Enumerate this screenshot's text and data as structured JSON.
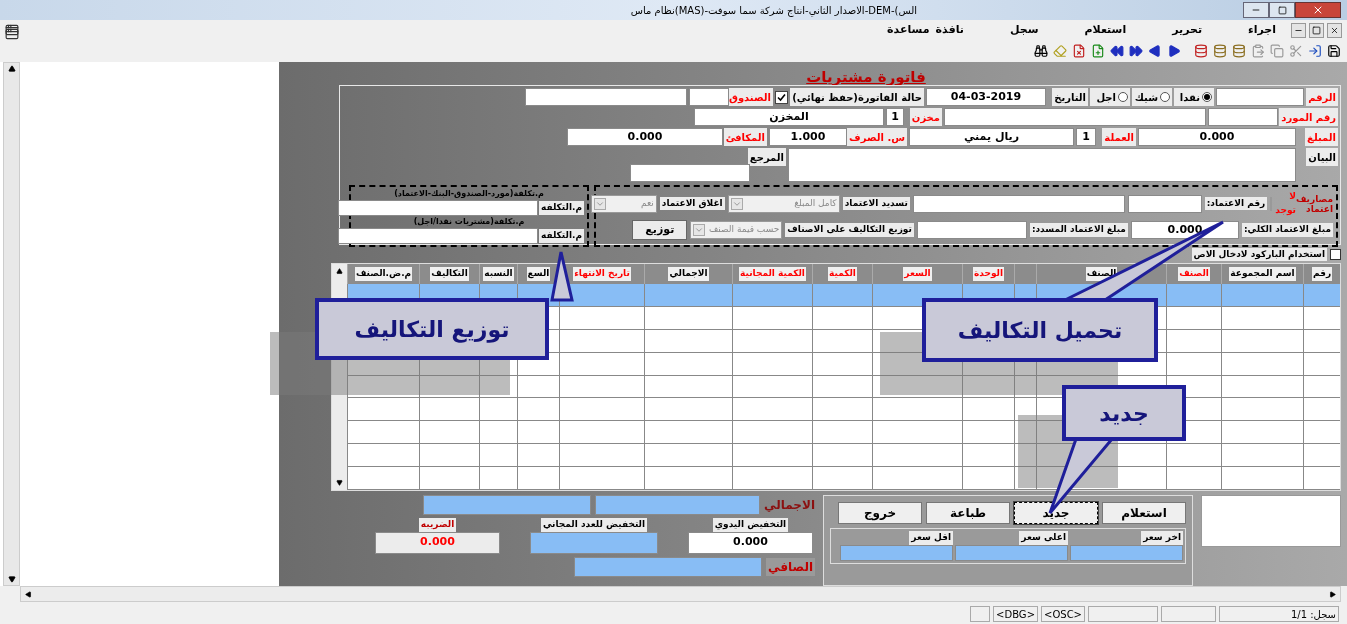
{
  "window": {
    "title": "نظام ماس(MAS)-الاصدار الثاني-انتاج شركة سما سوفت-DEM-(الس"
  },
  "menu": [
    "اجراء",
    "تحرير",
    "استعلام",
    "سجل",
    "نافذة",
    "مساعدة"
  ],
  "form": {
    "title": "فاتورة مشتريات",
    "rows": [
      {
        "items": [
          {
            "kind": "label",
            "text": "الرقم",
            "color": "#ff0000"
          },
          {
            "kind": "field"
          },
          {
            "kind": "radio",
            "text": "نقدا",
            "selected": true
          },
          {
            "kind": "radio",
            "text": "شيك",
            "selected": false
          },
          {
            "kind": "radio",
            "text": "اجل",
            "selected": false
          },
          {
            "kind": "label",
            "text": "التاريخ",
            "color": "#000000"
          },
          {
            "kind": "field",
            "value": "04-03-2019"
          },
          {
            "kind": "label",
            "text": "حالة الفاتورة(حفظ نهائي)",
            "color": "#000000"
          },
          {
            "kind": "check",
            "checked": true
          },
          {
            "kind": "label",
            "text": "الصندوق",
            "color": "#ff0000"
          },
          {
            "kind": "field"
          },
          {
            "kind": "field"
          }
        ]
      },
      {
        "items": [
          {
            "kind": "label",
            "text": "رقم المورد",
            "color": "#ff0000"
          },
          {
            "kind": "field"
          },
          {
            "kind": "field"
          },
          {
            "kind": "label",
            "text": "مخزن",
            "color": "#ff0000"
          },
          {
            "kind": "field",
            "value": "1"
          },
          {
            "kind": "field",
            "value": "المخزن"
          }
        ]
      },
      {
        "items": [
          {
            "kind": "label",
            "text": "المبلغ",
            "color": "#ff0000"
          },
          {
            "kind": "field",
            "value": "0.000"
          },
          {
            "kind": "label",
            "text": "العملة",
            "color": "#ff0000"
          },
          {
            "kind": "field",
            "value": "1"
          },
          {
            "kind": "field",
            "value": "ريال يمني"
          },
          {
            "kind": "label",
            "text": "س. الصرف",
            "color": "#ff0000"
          },
          {
            "kind": "field",
            "value": "1.000"
          },
          {
            "kind": "label",
            "text": "المكافئ",
            "color": "#ff0000"
          },
          {
            "kind": "field",
            "value": "0.000"
          }
        ]
      },
      {
        "items": [
          {
            "kind": "label",
            "text": "البيان",
            "color": "#000000"
          },
          {
            "kind": "memo"
          },
          {
            "kind": "label",
            "text": "المرجع",
            "color": "#000000"
          },
          {
            "kind": "field"
          }
        ]
      }
    ],
    "credit": {
      "title": "مصاريف اعتماد",
      "status": "لا توجد",
      "number_label": "رقم الاعتماد:",
      "settle_label": "تسديد الاعتماد",
      "settle_value": "كامل المبلغ",
      "settle_disabled": true,
      "close_label": "اغلاق الاعتماد",
      "close_value": "نعم",
      "close_disabled": true,
      "total_label": "مبلغ الاعتماد الكلي:",
      "total_value": "0.000",
      "paid_label": "مبلغ الاعتماد المسدد:",
      "distribute_label": "توزيع التكاليف على الاصناف",
      "distribute_value": "حسب قيمة الصنف",
      "distribute_disabled": true,
      "distribute_button": "توزيع"
    },
    "cost_centers": [
      {
        "title": "م.تكلفة(مورد-الصندوق-البنك-الاعتماد)",
        "label": "م.التكلفه"
      },
      {
        "title": "م.تكلفة(مشتريات نقدا/اجل)",
        "label": "م.التكلفه"
      }
    ],
    "barcode": {
      "label": "استخدام الباركود لادخال الاص",
      "checked": false
    }
  },
  "grid": {
    "columns": [
      {
        "label": "رقم",
        "color": "#000000"
      },
      {
        "label": "اسم المجموعة",
        "color": "#000000"
      },
      {
        "label": "الصنف",
        "color": "#ff0000"
      },
      {
        "label": "الصنف",
        "color": "#000000"
      },
      {
        "label": "الوحدة",
        "color": "#ff0000"
      },
      {
        "label": "السعر",
        "color": "#ff0000"
      },
      {
        "label": "الكمية",
        "color": "#ff0000"
      },
      {
        "label": "الكمية المجانية",
        "color": "#ff0000"
      },
      {
        "label": "الاجمالي",
        "color": "#000000"
      },
      {
        "label": "تاريخ الانتهاء",
        "color": "#ff0000"
      },
      {
        "label": "السع",
        "color": "#000000"
      },
      {
        "label": "النسبه",
        "color": "#000000"
      },
      {
        "label": "التكاليف",
        "color": "#000000"
      },
      {
        "label": "م.ض.الصنف",
        "color": "#000000"
      }
    ]
  },
  "totals": {
    "total_label": "الاجمالي",
    "tax_label": "الضريبه",
    "tax_value": "0.000",
    "free_discount_label": "التخفيض للعدد المجاني",
    "manual_discount_label": "التخفيض اليدوي",
    "manual_discount_value": "0.000",
    "net_label": "الصافي"
  },
  "buttons": [
    {
      "label": "استعلام",
      "focused": false
    },
    {
      "label": "جديد",
      "focused": true
    },
    {
      "label": "طباعة",
      "focused": false
    },
    {
      "label": "خروج",
      "focused": false
    }
  ],
  "prices": [
    "اخر سعر",
    "اعلى سعر",
    "اقل سعر"
  ],
  "callouts": [
    {
      "text": "تحميل التكاليف"
    },
    {
      "text": "توزيع التكاليف"
    },
    {
      "text": "جديد"
    }
  ],
  "status_bar": {
    "record": "سجل: 1/1",
    "flags": [
      "<OSC>",
      "<DBG>"
    ]
  }
}
